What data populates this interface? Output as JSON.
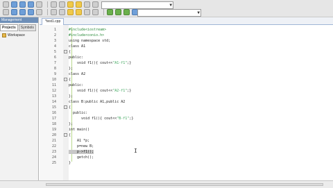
{
  "left_panel": {
    "title": "Management",
    "tabs": [
      {
        "label": "Projects",
        "active": true
      },
      {
        "label": "Symbols",
        "active": false
      }
    ],
    "tree_root": "Workspace"
  },
  "editor": {
    "tab_label": "*test1.cpp",
    "lines": [
      {
        "n": "1",
        "text": "#include<iostream>",
        "cls": "pp",
        "fold": ""
      },
      {
        "n": "2",
        "text": "#include<conio.h>",
        "cls": "pp",
        "fold": ""
      },
      {
        "n": "3",
        "text": "using namespace std;",
        "cls": "kw",
        "fold": ""
      },
      {
        "n": "4",
        "text": "class A1",
        "cls": "kw",
        "fold": ""
      },
      {
        "n": "5",
        "text": "{",
        "cls": "kw",
        "fold": "-"
      },
      {
        "n": "6",
        "text": "public:",
        "cls": "kw",
        "fold": ""
      },
      {
        "n": "7",
        "text": "    void f1(){ cout<<\"A1-f1\";}",
        "cls": "kw",
        "fold": ""
      },
      {
        "n": "8",
        "text": "};",
        "cls": "kw",
        "fold": ""
      },
      {
        "n": "9",
        "text": "class A2",
        "cls": "kw",
        "fold": ""
      },
      {
        "n": "10",
        "text": "{",
        "cls": "kw",
        "fold": "-"
      },
      {
        "n": "11",
        "text": "public:",
        "cls": "kw",
        "fold": ""
      },
      {
        "n": "12",
        "text": "    void f1(){ cout<<\"A2-f1\";}",
        "cls": "kw",
        "fold": ""
      },
      {
        "n": "13",
        "text": "};",
        "cls": "kw",
        "fold": ""
      },
      {
        "n": "14",
        "text": "class B:public A1,public A2",
        "cls": "kw",
        "fold": ""
      },
      {
        "n": "15",
        "text": "{",
        "cls": "kw",
        "fold": "-"
      },
      {
        "n": "16",
        "text": "  public:",
        "cls": "kw",
        "fold": ""
      },
      {
        "n": "17",
        "text": "      void f1(){ cout<<\"B-f1\";}",
        "cls": "kw",
        "fold": ""
      },
      {
        "n": "18",
        "text": "};",
        "cls": "kw",
        "fold": ""
      },
      {
        "n": "19",
        "text": "int main()",
        "cls": "kw",
        "fold": ""
      },
      {
        "n": "20",
        "text": "{",
        "cls": "kw",
        "fold": "-"
      },
      {
        "n": "21",
        "text": "    A1 *p;",
        "cls": "kw",
        "fold": ""
      },
      {
        "n": "22",
        "text": "    p=new B;",
        "cls": "kw",
        "fold": ""
      },
      {
        "n": "23",
        "text": "    p->f1();",
        "cls": "kw",
        "fold": "",
        "selected": true
      },
      {
        "n": "24",
        "text": "    getch();",
        "cls": "kw",
        "fold": ""
      },
      {
        "n": "25",
        "text": "}",
        "cls": "kw",
        "fold": ""
      }
    ]
  },
  "toolbar": {
    "row1_icons": [
      "new-file",
      "open-file",
      "save",
      "save-all",
      "cut",
      "copy",
      "paste",
      "undo",
      "redo",
      "find",
      "replace",
      "compile",
      "run",
      "compile-run",
      "rebuild",
      "debug",
      "stop"
    ],
    "row2_icons": [
      "back",
      "forward",
      "toggle-bookmark",
      "goto",
      "class-browser",
      "insert",
      "indent",
      "unindent",
      "toggle-comment",
      "fold",
      "unfold",
      "new-project",
      "project-options",
      "close-project",
      "help",
      "about",
      "check-syntax"
    ]
  }
}
